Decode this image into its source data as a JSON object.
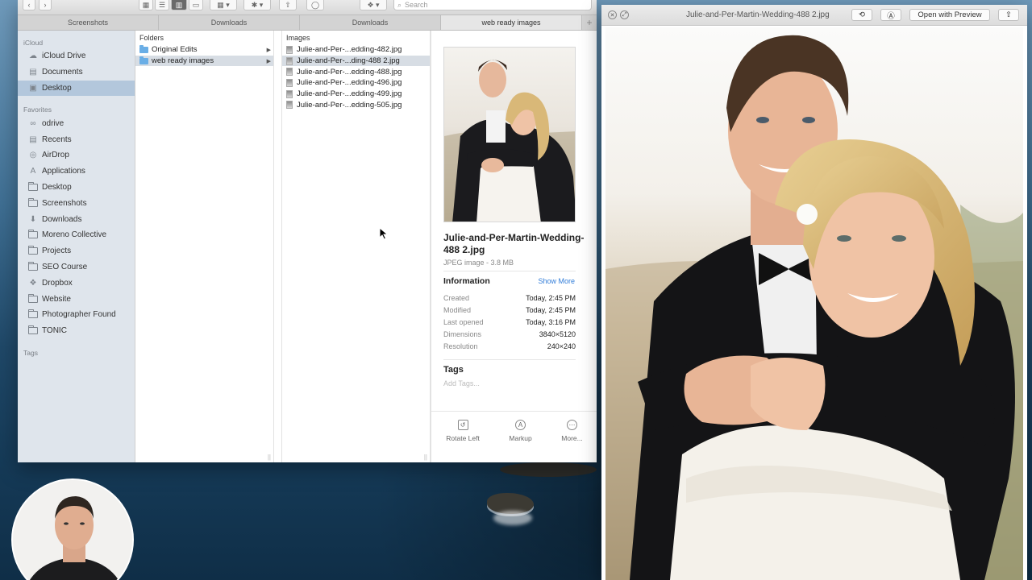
{
  "finder": {
    "search_placeholder": "Search",
    "tabs": [
      {
        "label": "Screenshots",
        "active": false
      },
      {
        "label": "Downloads",
        "active": false
      },
      {
        "label": "Downloads",
        "active": false
      },
      {
        "label": "web ready images",
        "active": true
      }
    ],
    "sidebar": {
      "icloud_heading": "iCloud",
      "icloud_items": [
        {
          "label": "iCloud Drive",
          "icon": "cloud-icon"
        },
        {
          "label": "Documents",
          "icon": "document-icon"
        },
        {
          "label": "Desktop",
          "icon": "desktop-icon",
          "selected": true
        }
      ],
      "favorites_heading": "Favorites",
      "favorites_items": [
        {
          "label": "odrive",
          "icon": "infinity-icon"
        },
        {
          "label": "Recents",
          "icon": "recents-icon"
        },
        {
          "label": "AirDrop",
          "icon": "airdrop-icon"
        },
        {
          "label": "Applications",
          "icon": "applications-icon"
        },
        {
          "label": "Desktop",
          "icon": "folder-icon"
        },
        {
          "label": "Screenshots",
          "icon": "folder-icon"
        },
        {
          "label": "Downloads",
          "icon": "downloads-icon"
        },
        {
          "label": "Moreno Collective",
          "icon": "folder-icon"
        },
        {
          "label": "Projects",
          "icon": "folder-icon"
        },
        {
          "label": "SEO Course",
          "icon": "folder-icon"
        },
        {
          "label": "Dropbox",
          "icon": "dropbox-icon"
        },
        {
          "label": "Website",
          "icon": "folder-icon"
        },
        {
          "label": "Photographer Found",
          "icon": "folder-icon"
        },
        {
          "label": "TONIC",
          "icon": "folder-icon"
        }
      ],
      "tags_heading": "Tags"
    },
    "folders_column": {
      "heading": "Folders",
      "items": [
        {
          "label": "Original Edits",
          "selected": false
        },
        {
          "label": "web ready images",
          "selected": true
        }
      ]
    },
    "images_column": {
      "heading": "Images",
      "items": [
        {
          "label": "Julie-and-Per-...edding-482.jpg",
          "selected": false
        },
        {
          "label": "Julie-and-Per-...ding-488 2.jpg",
          "selected": true
        },
        {
          "label": "Julie-and-Per-...edding-488.jpg",
          "selected": false
        },
        {
          "label": "Julie-and-Per-...edding-496.jpg",
          "selected": false
        },
        {
          "label": "Julie-and-Per-...edding-499.jpg",
          "selected": false
        },
        {
          "label": "Julie-and-Per-...edding-505.jpg",
          "selected": false
        }
      ]
    },
    "preview": {
      "name": "Julie-and-Per-Martin-Wedding-488 2.jpg",
      "type": "JPEG image - 3.8 MB",
      "info_heading": "Information",
      "show_more": "Show More",
      "info": [
        {
          "key": "Created",
          "value": "Today, 2:45 PM"
        },
        {
          "key": "Modified",
          "value": "Today, 2:45 PM"
        },
        {
          "key": "Last opened",
          "value": "Today, 3:16 PM"
        },
        {
          "key": "Dimensions",
          "value": "3840×5120"
        },
        {
          "key": "Resolution",
          "value": "240×240"
        }
      ],
      "tags_heading": "Tags",
      "add_tags": "Add Tags...",
      "actions": [
        {
          "label": "Rotate Left",
          "icon": "rotate-left-icon"
        },
        {
          "label": "Markup",
          "icon": "markup-icon"
        },
        {
          "label": "More...",
          "icon": "more-icon"
        }
      ]
    }
  },
  "quicklook": {
    "title": "Julie-and-Per-Martin-Wedding-488 2.jpg",
    "open_with": "Open with Preview"
  },
  "colors": {
    "sidebar_selected": "#b3c7dc",
    "link_blue": "#2f7bd8",
    "folder_blue": "#6aaee6"
  }
}
